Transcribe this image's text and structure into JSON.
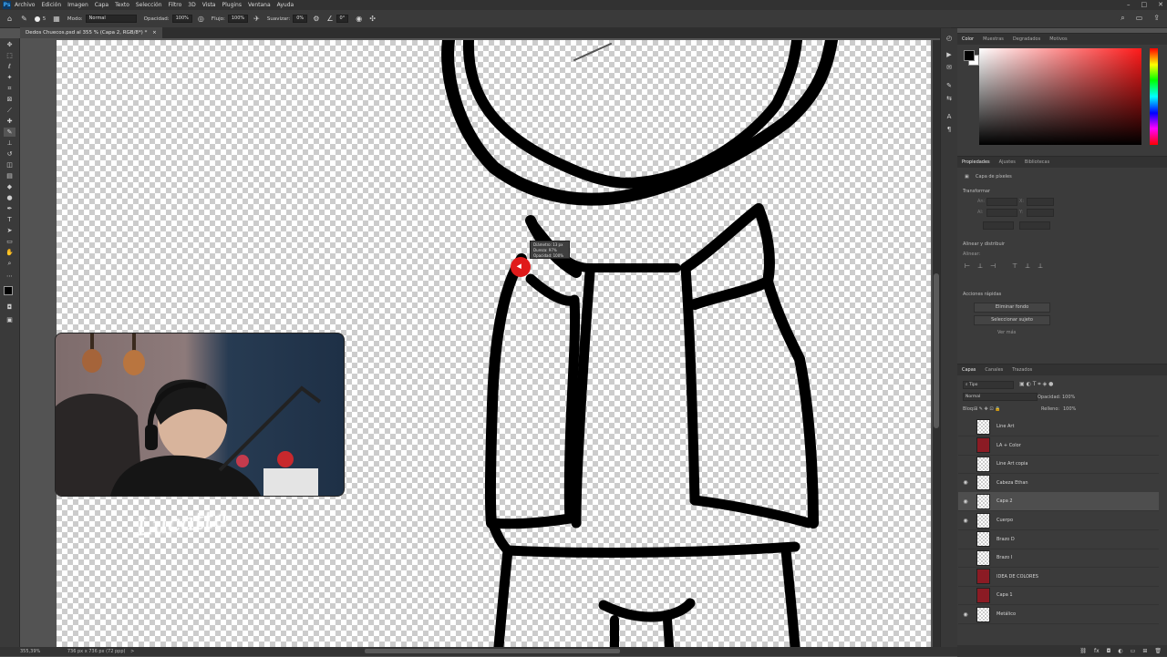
{
  "menu": [
    "Archivo",
    "Edición",
    "Imagen",
    "Capa",
    "Texto",
    "Selección",
    "Filtro",
    "3D",
    "Vista",
    "Plugins",
    "Ventana",
    "Ayuda"
  ],
  "window_controls": [
    "–",
    "□",
    "✕"
  ],
  "options": {
    "mode_label": "Modo:",
    "mode_value": "Normal",
    "opacity_label": "Opacidad:",
    "opacity_value": "100%",
    "flow_label": "Flujo:",
    "flow_value": "100%",
    "smooth_label": "Suavizar:",
    "smooth_value": "0%",
    "angle_value": "0°",
    "brush_size": "5"
  },
  "document": {
    "tab_title": "Dedos Chuecos.psd al 355 % (Capa 2, RGB/8*) *",
    "close": "×"
  },
  "brush_tooltip": {
    "line1": "Diámetro: 13 px",
    "line2": "Dureza: 97%",
    "line3": "Opacidad: 100%"
  },
  "watermark": "Lucatta",
  "status": {
    "zoom": "355,39%",
    "size": "736 px x 736 px (72 ppp)",
    "arrow": ">"
  },
  "color_panel": {
    "tabs": [
      "Color",
      "Muestras",
      "Degradados",
      "Motivos"
    ],
    "foreground": "#000000",
    "background": "#ffffff",
    "hue_color": "#ff1a1a"
  },
  "properties_panel": {
    "tabs": [
      "Propiedades",
      "Ajustes",
      "Bibliotecas"
    ],
    "layer_type": "Capa de píxeles",
    "transform_title": "Transformar",
    "fields": [
      "An:",
      "Al:",
      "X:",
      "Y:"
    ],
    "align_title": "Alinear y distribuir",
    "align_sub": "Alinear:",
    "quick_title": "Acciones rápidas",
    "buttons": [
      "Eliminar fondo",
      "Seleccionar sujeto"
    ],
    "more": "Ver más"
  },
  "layers_panel": {
    "tabs": [
      "Capas",
      "Canales",
      "Trazados"
    ],
    "filter": "Tipo",
    "blend": "Normal",
    "opacity_label": "Opacidad:",
    "opacity_value": "100%",
    "lock_label": "Bloq:",
    "fill_label": "Relleno:",
    "fill_value": "100%",
    "layers": [
      {
        "name": "Line Art",
        "visible": false,
        "thumb": "transparent"
      },
      {
        "name": "LA + Color",
        "visible": false,
        "thumb": "red"
      },
      {
        "name": "Line Art copia",
        "visible": false,
        "thumb": "transparent"
      },
      {
        "name": "Cabeza Ethan",
        "visible": true,
        "thumb": "transparent"
      },
      {
        "name": "Capa 2",
        "visible": true,
        "thumb": "transparent",
        "selected": true
      },
      {
        "name": "Cuerpo",
        "visible": true,
        "thumb": "transparent"
      },
      {
        "name": "Brazo D",
        "visible": false,
        "thumb": "transparent"
      },
      {
        "name": "Brazo I",
        "visible": false,
        "thumb": "transparent"
      },
      {
        "name": "IDEA DE COLORES",
        "visible": false,
        "thumb": "red"
      },
      {
        "name": "Capa 1",
        "visible": false,
        "thumb": "red"
      },
      {
        "name": "Metálico",
        "visible": true,
        "thumb": "transparent"
      }
    ]
  }
}
